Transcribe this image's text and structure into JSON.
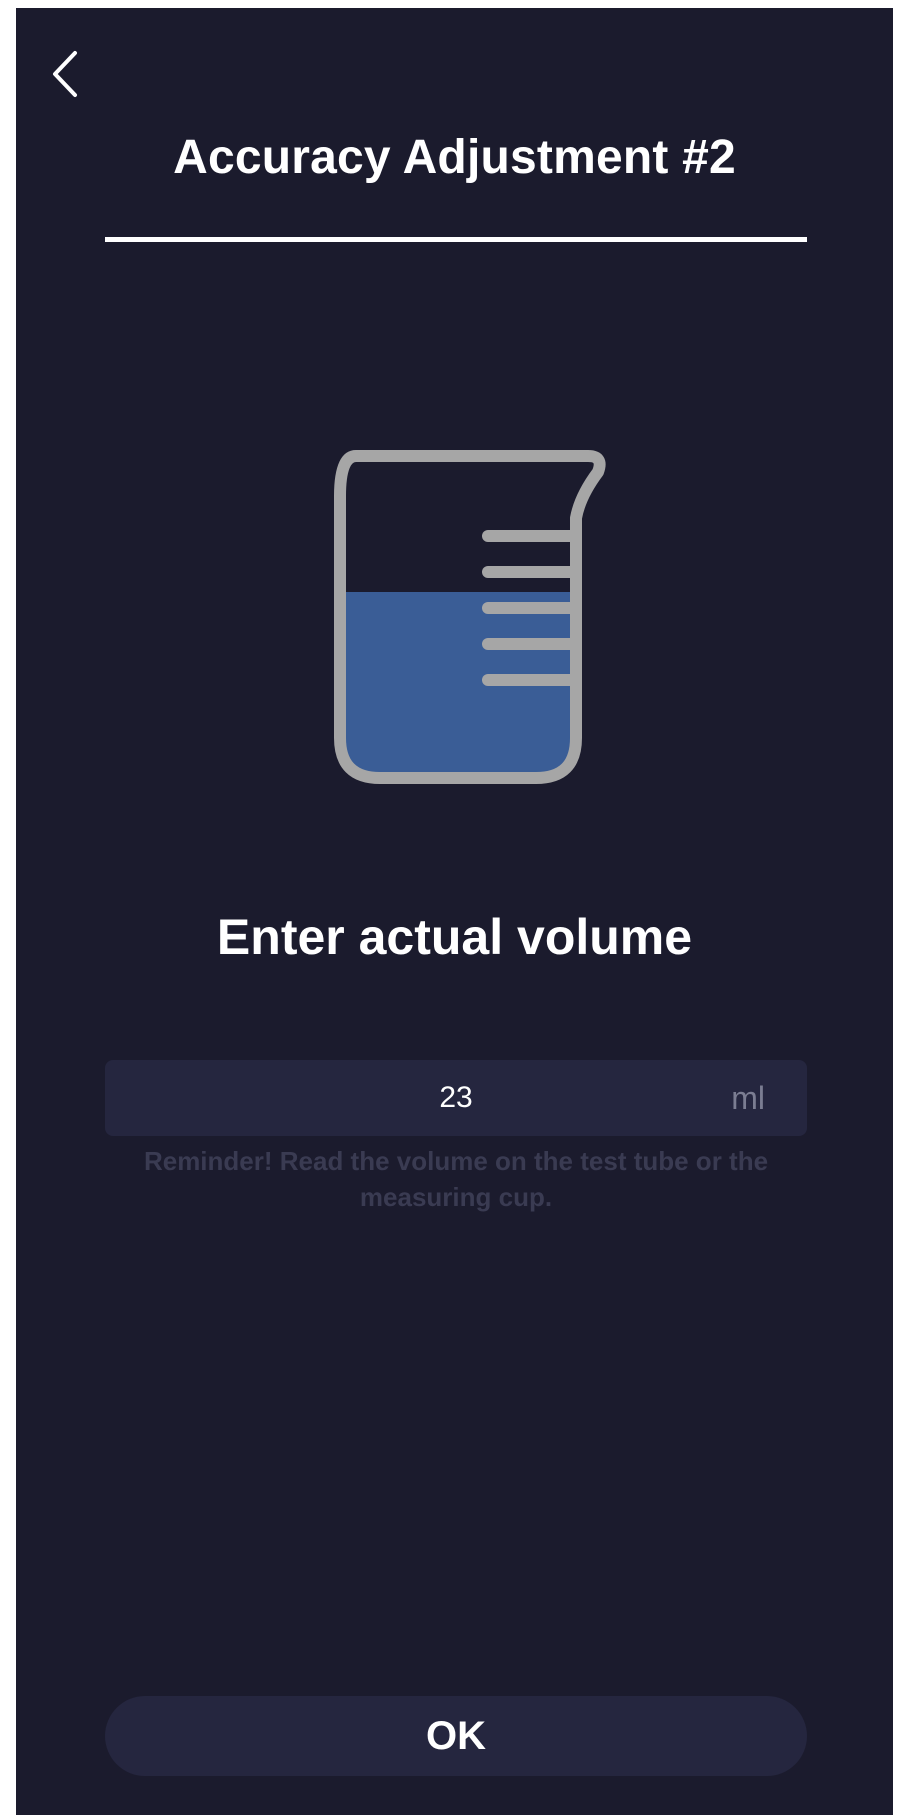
{
  "header": {
    "title": "Accuracy Adjustment #2",
    "back_icon": "chevron-left-icon"
  },
  "illustration": {
    "icon": "beaker-icon",
    "glass_color": "#a6a6a6",
    "liquid_color": "#3a5d96"
  },
  "main": {
    "prompt": "Enter actual volume",
    "volume_input": {
      "value": "23",
      "unit": "ml"
    },
    "reminder": "Reminder! Read the volume on the test tube or the measuring cup."
  },
  "footer": {
    "ok_label": "OK"
  },
  "colors": {
    "background": "#1b1b2d",
    "field_background": "#25263f",
    "text": "#ffffff",
    "muted_text": "#3a3b52"
  }
}
